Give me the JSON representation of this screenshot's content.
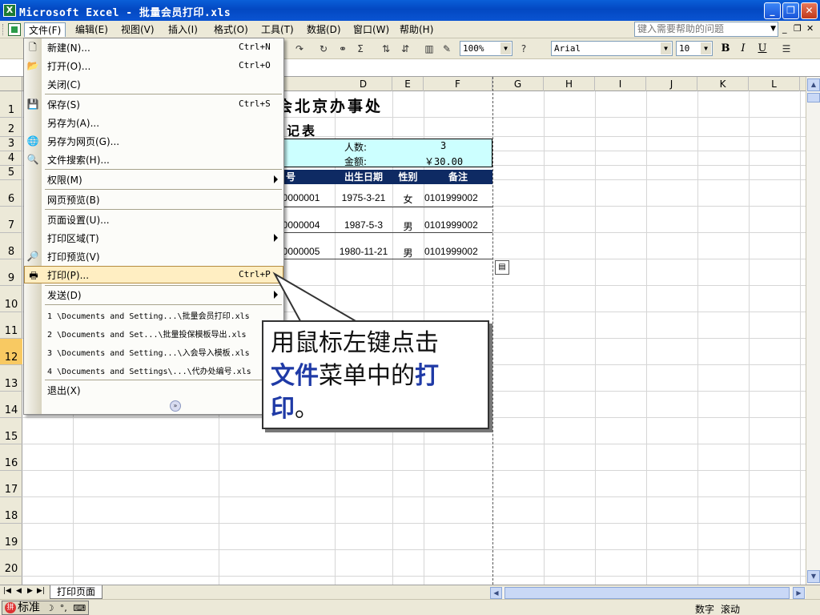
{
  "window": {
    "title": "Microsoft Excel - 批量会员打印.xls",
    "app_icon": "X",
    "minimize": "_",
    "restore": "❐",
    "close": "✕"
  },
  "menubar": {
    "items": [
      "文件(F)",
      "编辑(E)",
      "视图(V)",
      "插入(I)",
      "格式(O)",
      "工具(T)",
      "数据(D)",
      "窗口(W)",
      "帮助(H)"
    ],
    "help_placeholder": "键入需要帮助的问题"
  },
  "toolbar": {
    "zoom": "100%",
    "font": "Arial",
    "size": "10",
    "bold": "B",
    "italic": "I",
    "underline": "U"
  },
  "columns": [
    "D",
    "E",
    "F",
    "G",
    "H",
    "I",
    "J",
    "K",
    "L"
  ],
  "rows": [
    "1",
    "2",
    "3",
    "4",
    "5",
    "6",
    "7",
    "8",
    "9",
    "10",
    "11",
    "12",
    "13",
    "14",
    "15",
    "16",
    "17",
    "18",
    "19",
    "20"
  ],
  "sheet": {
    "title_partial": "会北京办事处",
    "subtitle_partial": "记表",
    "count_label": "人数:",
    "count_value": "3",
    "amount_label": "金额:",
    "amount_value": "￥30.00",
    "headers": [
      "号",
      "出生日期",
      "性别",
      "备注"
    ],
    "data_rows": [
      [
        "00000001",
        "1975-3-21",
        "女",
        "0101999002"
      ],
      [
        "00000004",
        "1987-5-3",
        "男",
        "0101999002"
      ],
      [
        "00000005",
        "1980-11-21",
        "男",
        "0101999002"
      ]
    ]
  },
  "file_menu": {
    "items": [
      {
        "label": "新建(N)...",
        "shortcut": "Ctrl+N",
        "icon": "new-doc-icon"
      },
      {
        "label": "打开(O)...",
        "shortcut": "Ctrl+O",
        "icon": "open-folder-icon"
      },
      {
        "label": "关闭(C)",
        "shortcut": "",
        "icon": ""
      },
      {
        "label": "保存(S)",
        "shortcut": "Ctrl+S",
        "icon": "save-icon"
      },
      {
        "label": "另存为(A)...",
        "shortcut": "",
        "icon": ""
      },
      {
        "label": "另存为网页(G)...",
        "shortcut": "",
        "icon": "web-page-icon"
      },
      {
        "label": "文件搜索(H)...",
        "shortcut": "",
        "icon": "search-icon"
      },
      {
        "label": "权限(M)",
        "shortcut": "",
        "icon": ""
      },
      {
        "label": "网页预览(B)",
        "shortcut": "",
        "icon": ""
      },
      {
        "label": "页面设置(U)...",
        "shortcut": "",
        "icon": ""
      },
      {
        "label": "打印区域(T)",
        "shortcut": "",
        "icon": ""
      },
      {
        "label": "打印预览(V)",
        "shortcut": "",
        "icon": "print-preview-icon"
      },
      {
        "label": "打印(P)...",
        "shortcut": "Ctrl+P",
        "icon": "print-icon"
      },
      {
        "label": "发送(D)",
        "shortcut": "",
        "icon": ""
      },
      {
        "label": "1 \\Documents and Setting...\\批量会员打印.xls",
        "shortcut": "",
        "icon": ""
      },
      {
        "label": "2 \\Documents and Set...\\批量投保模板导出.xls",
        "shortcut": "",
        "icon": ""
      },
      {
        "label": "3 \\Documents and Setting...\\入会导入模板.xls",
        "shortcut": "",
        "icon": ""
      },
      {
        "label": "4 \\Documents and Settings\\...\\代办处编号.xls",
        "shortcut": "",
        "icon": ""
      },
      {
        "label": "退出(X)",
        "shortcut": "",
        "icon": ""
      }
    ]
  },
  "callout": {
    "line1": "用鼠标左键点击",
    "em1": "文件",
    "mid": "菜单中的",
    "em2": "打",
    "em3": "印",
    "end": "。"
  },
  "sheet_tab": "打印页面",
  "statusbar": {
    "ime": "标准",
    "num": "数字",
    "scroll": "滚动"
  }
}
